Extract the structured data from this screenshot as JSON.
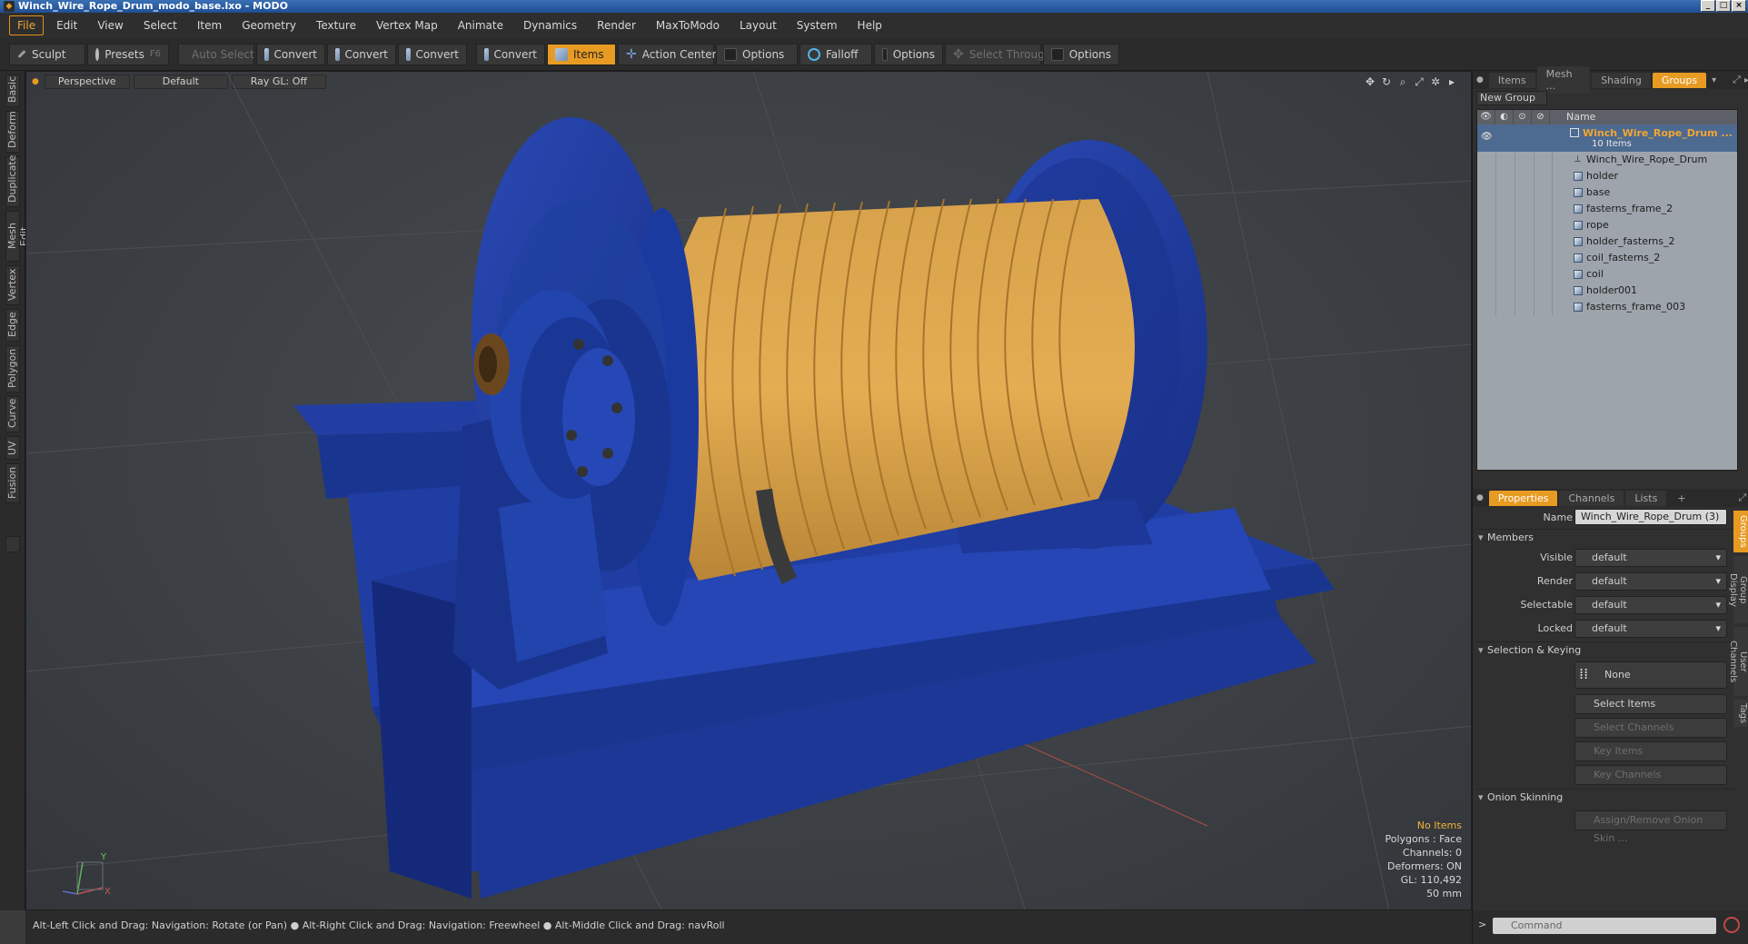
{
  "window": {
    "title": "Winch_Wire_Rope_Drum_modo_base.lxo - MODO"
  },
  "menu": [
    "File",
    "Edit",
    "View",
    "Select",
    "Item",
    "Geometry",
    "Texture",
    "Vertex Map",
    "Animate",
    "Dynamics",
    "Render",
    "MaxToModo",
    "Layout",
    "System",
    "Help"
  ],
  "toolbar": {
    "sculpt": "Sculpt",
    "presets": "Presets",
    "presets_key": "F6",
    "auto_select": "Auto Select",
    "convert1": "Convert",
    "convert2": "Convert",
    "convert3": "Convert",
    "convert4": "Convert",
    "items": "Items",
    "action_center": "Action Center",
    "options1": "Options",
    "falloff": "Falloff",
    "options2": "Options",
    "select_through": "Select Through",
    "options3": "Options"
  },
  "left_tabs": [
    "Basic",
    "Deform",
    "Duplicate",
    "Mesh Edit",
    "Vertex",
    "Edge",
    "Polygon",
    "Curve",
    "UV",
    "Fusion"
  ],
  "viewport": {
    "view": "Perspective",
    "shading": "Default",
    "raygl": "Ray GL: Off",
    "info": {
      "selection": "No Items",
      "polygons": "Polygons : Face",
      "channels": "Channels: 0",
      "deformers": "Deformers: ON",
      "gl": "GL: 110,492",
      "scale": "50 mm"
    },
    "axis": {
      "x": "X",
      "y": "Y"
    }
  },
  "statusbar": {
    "hint": "Alt-Left Click and Drag: Navigation: Rotate (or Pan) ● Alt-Right Click and Drag: Navigation: Freewheel ● Alt-Middle Click and Drag: navRoll"
  },
  "item_panel": {
    "tabs": [
      "Items",
      "Mesh ...",
      "Shading",
      "Groups"
    ],
    "active_tab": "Groups",
    "new_group": "New Group",
    "name_header": "Name",
    "group": {
      "name": "Winch_Wire_Rope_Drum ...",
      "count": "10 Items"
    },
    "items": [
      "Winch_Wire_Rope_Drum",
      "holder",
      "base",
      "fasterns_frame_2",
      "rope",
      "holder_fasterns_2",
      "coil_fasterns_2",
      "coil",
      "holder001",
      "fasterns_frame_003"
    ]
  },
  "properties": {
    "tabs": [
      "Properties",
      "Channels",
      "Lists"
    ],
    "plus": "+",
    "name_label": "Name",
    "name_value": "Winch_Wire_Rope_Drum (3)",
    "members": "Members",
    "visible_label": "Visible",
    "visible_value": "default",
    "render_label": "Render",
    "render_value": "default",
    "selectable_label": "Selectable",
    "selectable_value": "default",
    "locked_label": "Locked",
    "locked_value": "default",
    "selection_keying": "Selection & Keying",
    "none": "None",
    "select_items": "Select Items",
    "select_channels": "Select Channels",
    "key_items": "Key Items",
    "key_channels": "Key Channels",
    "onion": "Onion Skinning",
    "assign_onion": "Assign/Remove Onion Skin ..."
  },
  "right_vtabs": [
    "Groups",
    "Group Display",
    "User Channels",
    "Tags"
  ],
  "command": {
    "placeholder": "Command",
    "prompt": ">"
  },
  "colors": {
    "accent": "#e79b23",
    "drum_blue": "#1f3da3",
    "rope_yellow": "#e0a743"
  }
}
